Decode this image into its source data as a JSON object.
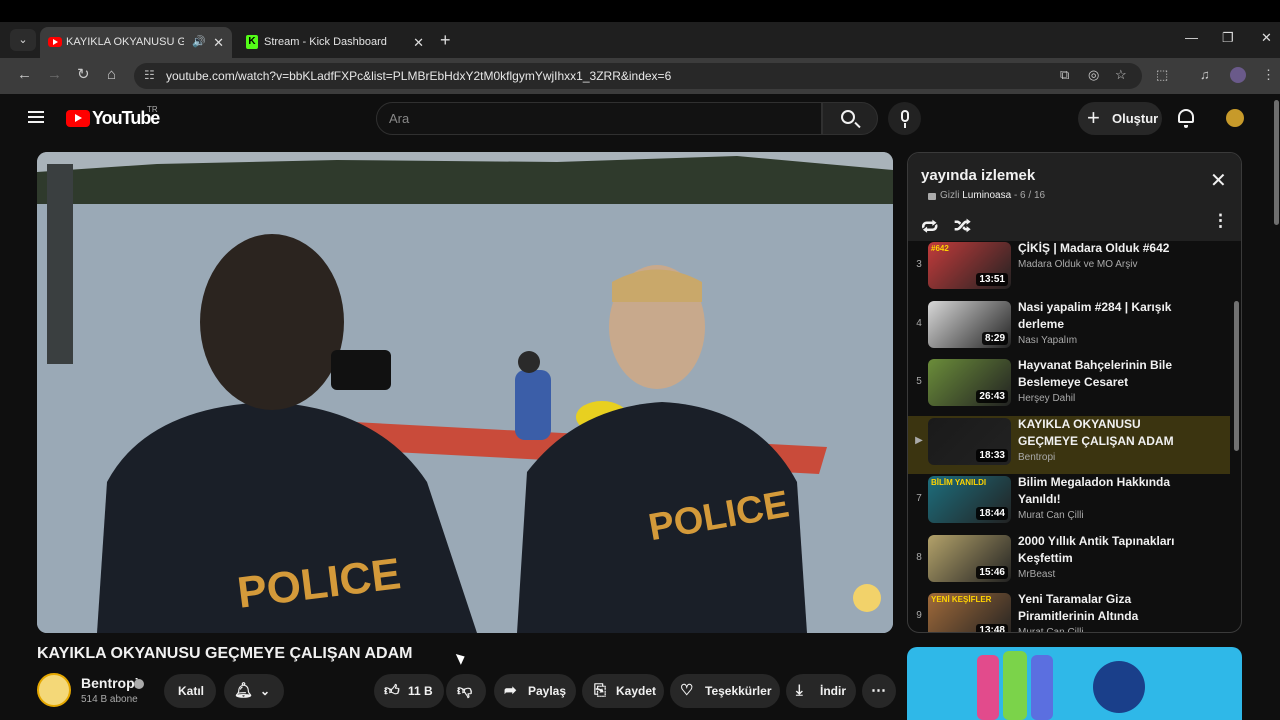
{
  "browser": {
    "tabs": [
      {
        "title": "KAYIKLA OKYANUSU GEÇMEYE ÇALIŞAN ADAM",
        "active": true
      },
      {
        "title": "Stream - Kick Dashboard",
        "active": false
      }
    ],
    "url": "youtube.com/watch?v=bbKLadfFXPc&list=PLMBrEbHdxY2tM0kflgymYwjIhxx1_3ZRR&index=6"
  },
  "youtube": {
    "logo_text": "YouTube",
    "country_code": "TR",
    "search_placeholder": "Ara",
    "create_label": "Oluştur"
  },
  "video": {
    "title": "KAYIKLA OKYANUSU GEÇMEYE ÇALIŞAN ADAM",
    "channel": "Bentropi",
    "subscribers": "514 B abone",
    "join_label": "Katıl",
    "likes": "11 B",
    "share_label": "Paylaş",
    "save_label": "Kaydet",
    "thanks_label": "Teşekkürler",
    "download_label": "İndir",
    "scene_text_left": "POLICE",
    "scene_text_right": "POLICE"
  },
  "playlist": {
    "title": "yayında izlemek",
    "privacy": "Gizli",
    "owner": "Luminoasa",
    "position": "6 / 16",
    "items": [
      {
        "index": "3",
        "title": "ÇİKİŞ | Madara Olduk #642",
        "channel": "Madara Olduk ve MO Arşiv",
        "duration": "13:51",
        "thumb_color": "#c23b3b",
        "badge": "#642"
      },
      {
        "index": "4",
        "title": "Nasi yapalim #284 | Karışık derleme",
        "channel": "Nası Yapalım",
        "duration": "8:29",
        "thumb_color": "#d8d8d8",
        "badge": ""
      },
      {
        "index": "5",
        "title": "Hayvanat Bahçelerinin Bile Beslemeye Cesaret Edemediğ...",
        "channel": "Herşey Dahil",
        "duration": "26:43",
        "thumb_color": "#6b8d3a",
        "badge": ""
      },
      {
        "index": "▶",
        "title": "KAYIKLA OKYANUSU GEÇMEYE ÇALIŞAN ADAM",
        "channel": "Bentropi",
        "duration": "18:33",
        "thumb_color": "#1a1a1a",
        "badge": ""
      },
      {
        "index": "7",
        "title": "Bilim Megaladon Hakkında Yanıldı!",
        "channel": "Murat Can Çilli",
        "duration": "18:44",
        "thumb_color": "#1d6e7d",
        "badge": "BİLİM YANILDI"
      },
      {
        "index": "8",
        "title": "2000 Yıllık Antik Tapınakları Keşfettim",
        "channel": "MrBeast",
        "duration": "15:46",
        "thumb_color": "#b3a26a",
        "badge": ""
      },
      {
        "index": "9",
        "title": "Yeni Taramalar Giza Piramitlerinin Altında Şaşırtıcı...",
        "channel": "Murat Can Çilli",
        "duration": "13:48",
        "thumb_color": "#a06a3a",
        "badge": "YENİ KEŞİFLER"
      }
    ]
  },
  "colors": {
    "background": "#0f0f0f",
    "youtube_red": "#ff0000",
    "current_item": "#3b3410",
    "kick_green": "#53fc18"
  }
}
